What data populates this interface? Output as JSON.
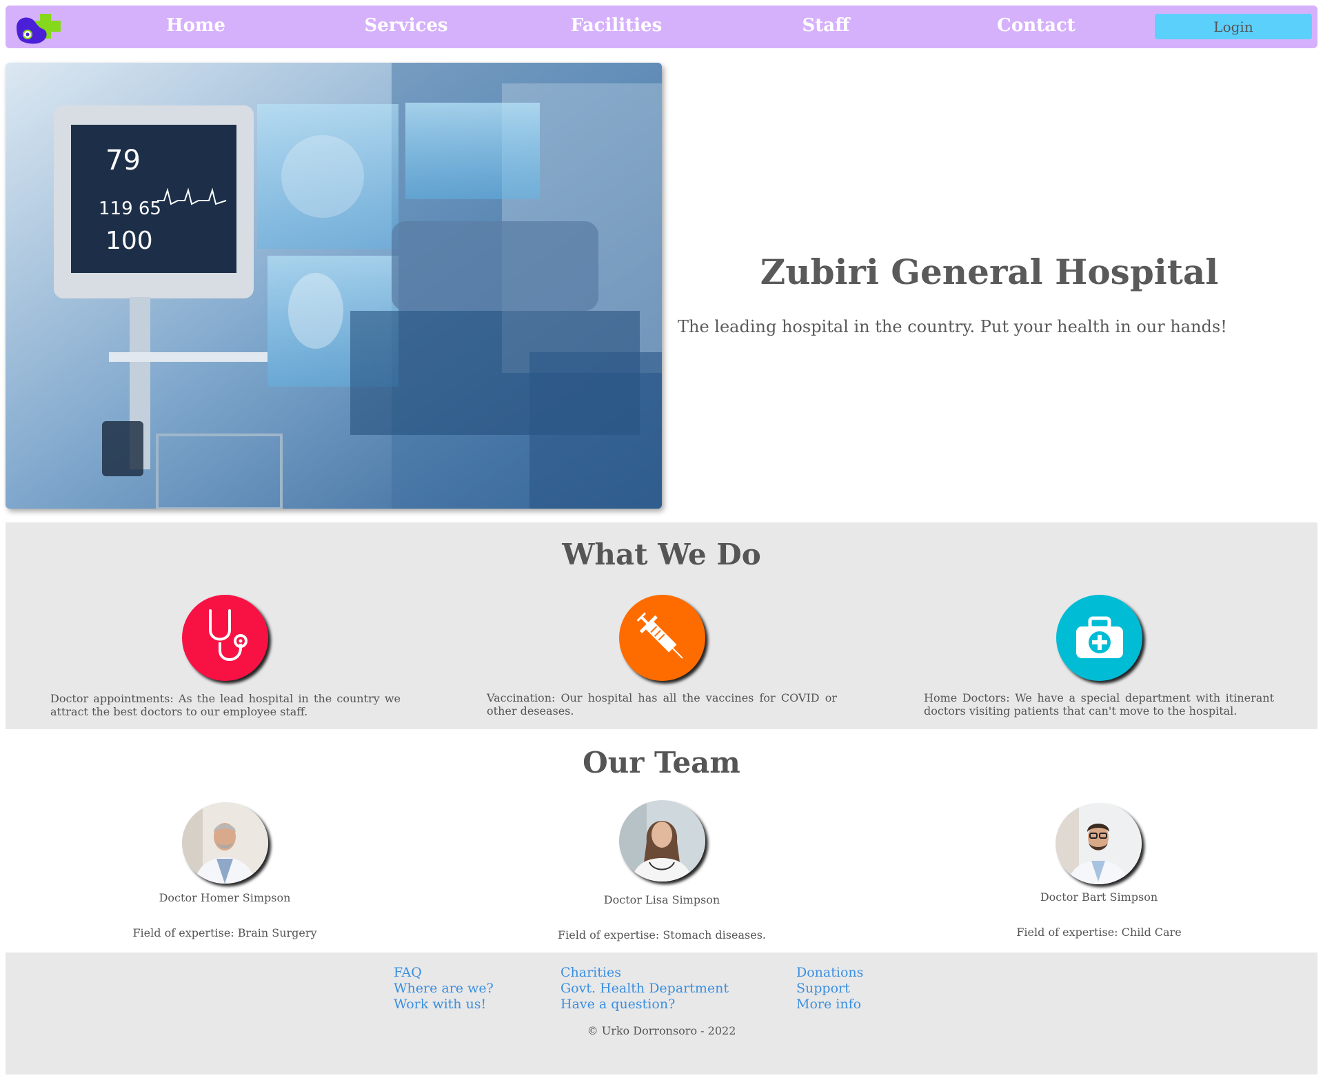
{
  "nav": {
    "logo_icon": "hospital-cross-logo-icon",
    "links": [
      "Home",
      "Services",
      "Facilities",
      "Staff",
      "Contact"
    ],
    "login_label": "Login",
    "background_color": "#d6b1fb",
    "login_color": "#5bd0fb"
  },
  "hero": {
    "image_icon": "hospital-monitor-image",
    "title": "Zubiri General Hospital",
    "subtitle": "The leading hospital in the country. Put your health in our hands!"
  },
  "services": {
    "title": "What We Do",
    "items": [
      {
        "icon": "stethoscope-icon",
        "color": "#f81244",
        "text": "Doctor appointments: As the lead hospital in the country we attract the best doctors to our employee staff."
      },
      {
        "icon": "syringe-icon",
        "color": "#fe6c00",
        "text": "Vaccination: Our hospital has all the vaccines for COVID or other deseases."
      },
      {
        "icon": "medical-kit-icon",
        "color": "#00bcd4",
        "text": "Home Doctors: We have a special department with itinerant doctors visiting patients that can't move to the hospital."
      }
    ]
  },
  "team": {
    "title": "Our Team",
    "members": [
      {
        "name": "Doctor Homer Simpson",
        "field": "Field of expertise: Brain Surgery"
      },
      {
        "name": "Doctor Lisa Simpson",
        "field": "Field of expertise: Stomach diseases."
      },
      {
        "name": "Doctor Bart Simpson",
        "field": "Field of expertise: Child Care"
      }
    ]
  },
  "footer": {
    "columns": [
      [
        "FAQ",
        "Where are we?",
        "Work with us!"
      ],
      [
        "Charities",
        "Govt. Health Department",
        "Have a question?"
      ],
      [
        "Donations",
        "Support",
        "More info"
      ]
    ],
    "copyright": "© Urko Dorronsoro - 2022",
    "link_color": "#3a8fe0"
  }
}
